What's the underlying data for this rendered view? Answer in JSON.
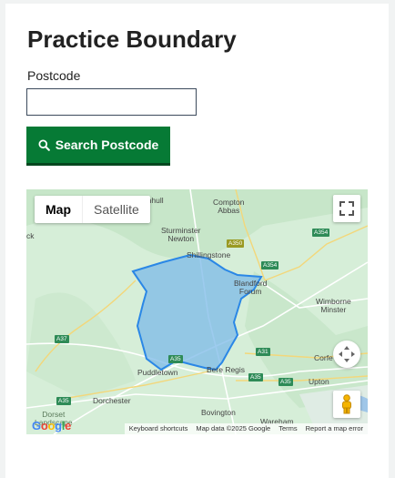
{
  "page": {
    "title": "Practice Boundary"
  },
  "form": {
    "postcode_label": "Postcode",
    "postcode_value": "",
    "search_button_label": "Search Postcode"
  },
  "map": {
    "map_type": {
      "map_label": "Map",
      "satellite_label": "Satellite",
      "selected": "Map"
    },
    "places": {
      "marnhull": "Marnhull",
      "compton_abbas": "Compton\nAbbas",
      "sturminster_newton": "Sturminster\nNewton",
      "shillingstone": "Shillingstone",
      "blandford_forum": "Blandford\nForum",
      "wimborne_minster": "Wimborne\nMinster",
      "corfe_mullen": "Corfe M",
      "puddletown": "Puddletown",
      "bere_regis": "Bere Regis",
      "dorchester": "Dorchester",
      "upton": "Upton",
      "bovington": "Bovington",
      "wareham": "Wareham",
      "dorset_landscape": "Dorset\nLandscape",
      "edge_ck": "ck",
      "edge_p": "P"
    },
    "roads": [
      "A350",
      "A354",
      "A354",
      "A37",
      "A35",
      "A31",
      "A35",
      "A35",
      "A35"
    ],
    "attribution": {
      "keyboard": "Keyboard shortcuts",
      "data": "Map data ©2025 Google",
      "terms": "Terms",
      "report": "Report a map error"
    },
    "colors": {
      "boundary_stroke": "#2a87e6",
      "boundary_fill": "#7cb9e8",
      "land": "#d8efd9",
      "primary": "#067a35"
    }
  }
}
